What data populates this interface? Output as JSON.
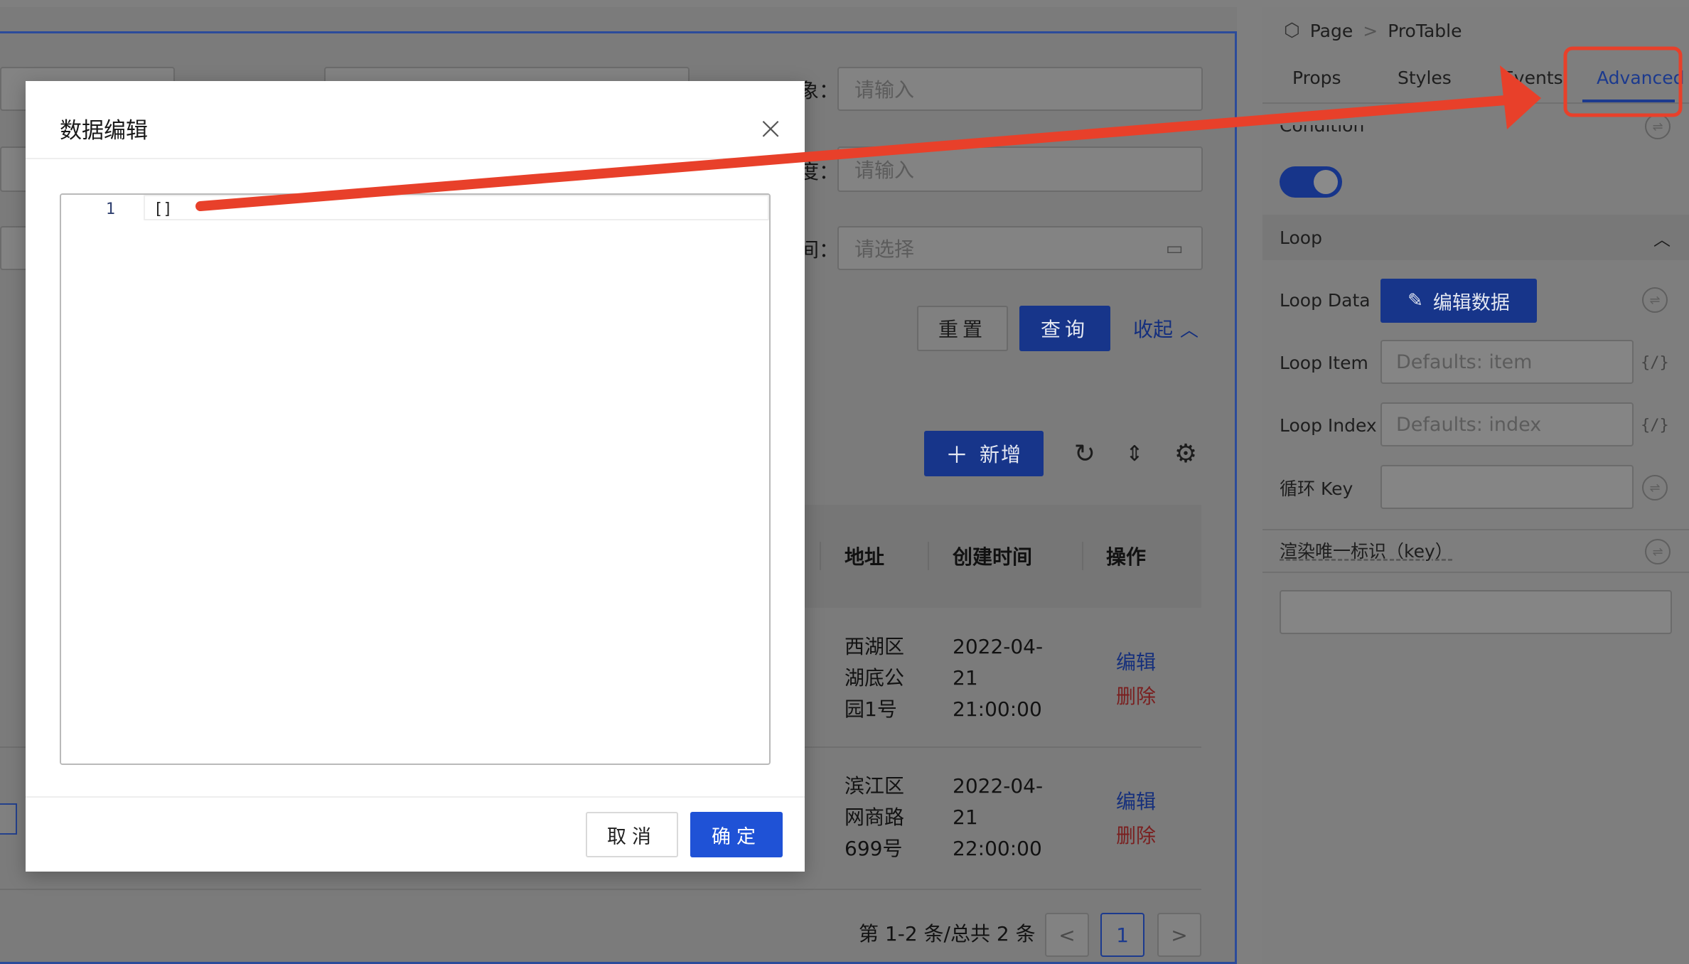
{
  "canvas": {
    "form": {
      "field_label_1": "象：",
      "field_placeholder_1": "请输入",
      "field_label_2": "度：",
      "field_placeholder_2": "请输入",
      "field_label_3": "间：",
      "field_placeholder_3": "请选择",
      "reset_label": "重置",
      "query_label": "查询",
      "collapse_label": "收起"
    },
    "toolbar": {
      "add_label": "新增"
    },
    "table": {
      "columns": [
        "地址",
        "创建时间",
        "操作"
      ],
      "rows": [
        {
          "address_lines": [
            "西湖区",
            "湖底公",
            "园1号"
          ],
          "time_lines": [
            "2022-04-",
            "21",
            "21:00:00"
          ],
          "edit": "编辑",
          "delete": "删除"
        },
        {
          "address_lines": [
            "滨江区",
            "网商路",
            "699号"
          ],
          "time_lines": [
            "2022-04-",
            "21",
            "22:00:00"
          ],
          "edit": "编辑",
          "delete": "删除"
        }
      ]
    },
    "pagination": {
      "summary": "第 1-2 条/总共 2 条",
      "current_page": "1",
      "prev": "<",
      "next": ">"
    }
  },
  "panel": {
    "breadcrumb": {
      "root": "Page",
      "separator": ">",
      "current": "ProTable"
    },
    "tabs": [
      "Props",
      "Styles",
      "Events",
      "Advanced"
    ],
    "active_tab": "Advanced",
    "condition_label": "Condition",
    "condition_enabled": true,
    "loop_section_title": "Loop",
    "loop_data_label": "Loop Data",
    "loop_data_button": "编辑数据",
    "loop_item_label": "Loop Item",
    "loop_item_placeholder": "Defaults: item",
    "loop_index_label": "Loop Index",
    "loop_index_placeholder": "Defaults: index",
    "loop_key_label": "循环 Key",
    "loop_key_value": "",
    "render_key_label": "渲染唯一标识（key）",
    "render_key_value": "",
    "expr_icon_text": "{/}"
  },
  "modal": {
    "title": "数据编辑",
    "close_symbol": "×",
    "editor": {
      "line_number": "1",
      "code": "[]"
    },
    "cancel_label": "取消",
    "ok_label": "确定"
  },
  "colors": {
    "primary": "#1f52d6",
    "annotation_red": "#e8402a",
    "danger_text": "#7a1f1f"
  }
}
